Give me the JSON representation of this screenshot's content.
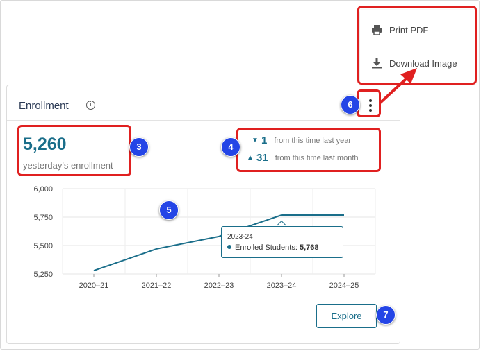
{
  "card": {
    "title": "Enrollment",
    "info_glyph": "i",
    "stat_value": "5,260",
    "stat_caption": "yesterday's enrollment",
    "changes": [
      {
        "direction": "down",
        "value": "1",
        "text": "from this time last year"
      },
      {
        "direction": "up",
        "value": "31",
        "text": "from this time last month"
      }
    ],
    "explore_label": "Explore"
  },
  "menu": {
    "items": [
      {
        "label": "Print PDF",
        "icon": "printer-icon"
      },
      {
        "label": "Download Image",
        "icon": "download-icon"
      }
    ]
  },
  "tooltip": {
    "title": "2023-24",
    "series_label": "Enrolled Students: ",
    "value": "5,768"
  },
  "annotations": {
    "badges": [
      "3",
      "4",
      "5",
      "6",
      "7"
    ],
    "highlight_color": "#e02020",
    "badge_color": "#2445e6"
  },
  "colors": {
    "accent": "#1a6e8a"
  },
  "chart_data": {
    "type": "line",
    "categories": [
      "2020–21",
      "2021–22",
      "2022–23",
      "2023–24",
      "2024–25"
    ],
    "y_ticks": [
      "6,000",
      "5,750",
      "5,500",
      "5,250"
    ],
    "tick_values": [
      6000,
      5750,
      5500,
      5250
    ],
    "series": [
      {
        "name": "Enrolled Students",
        "values": [
          5280,
          5470,
          5580,
          5768,
          5768
        ]
      }
    ],
    "ylim": [
      5250,
      6000
    ],
    "grid": true,
    "title": "",
    "xlabel": "",
    "ylabel": ""
  }
}
